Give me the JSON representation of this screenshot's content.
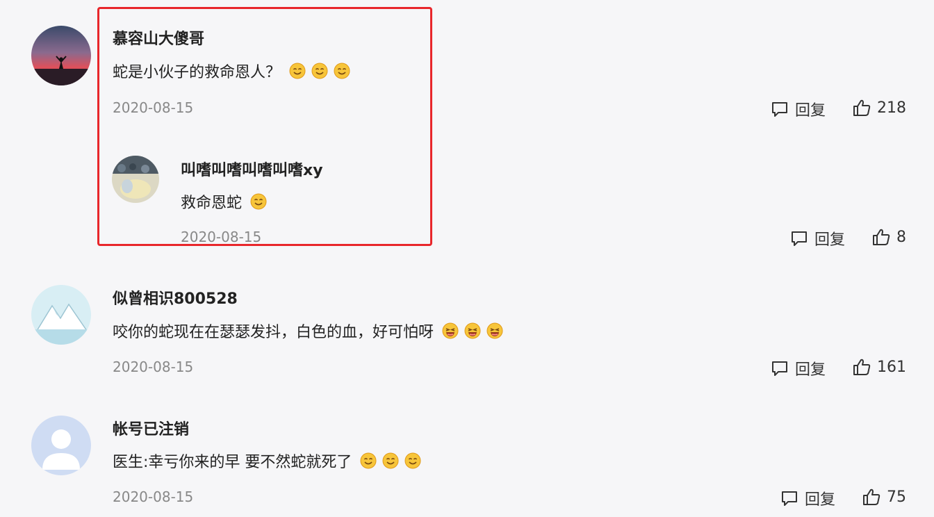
{
  "comments": [
    {
      "username": "慕容山大傻哥",
      "text": "蛇是小伙子的救命恩人？",
      "emojis": [
        "smile-emoji",
        "smile-emoji",
        "smile-emoji"
      ],
      "date": "2020-08-15",
      "reply_label": "回复",
      "likes": "218",
      "reply": {
        "username": "叫嗜叫嗜叫嗜叫嗜xy",
        "text": "救命恩蛇",
        "emojis": [
          "smile-emoji"
        ],
        "date": "2020-08-15",
        "reply_label": "回复",
        "likes": "8"
      }
    },
    {
      "username": "似曾相识800528",
      "text": "咬你的蛇现在在瑟瑟发抖，白色的血，好可怕呀",
      "emojis": [
        "laugh-emoji",
        "laugh-emoji",
        "laugh-emoji"
      ],
      "date": "2020-08-15",
      "reply_label": "回复",
      "likes": "161"
    },
    {
      "username": "帐号已注销",
      "text": "医生:幸亏你来的早 要不然蛇就死了",
      "emojis": [
        "smile-emoji",
        "smile-emoji",
        "smile-emoji"
      ],
      "date": "2020-08-15",
      "reply_label": "回复",
      "likes": "75"
    }
  ],
  "colors": {
    "highlight": "#e8262b",
    "date": "#888888",
    "background": "#f6f6f8"
  }
}
